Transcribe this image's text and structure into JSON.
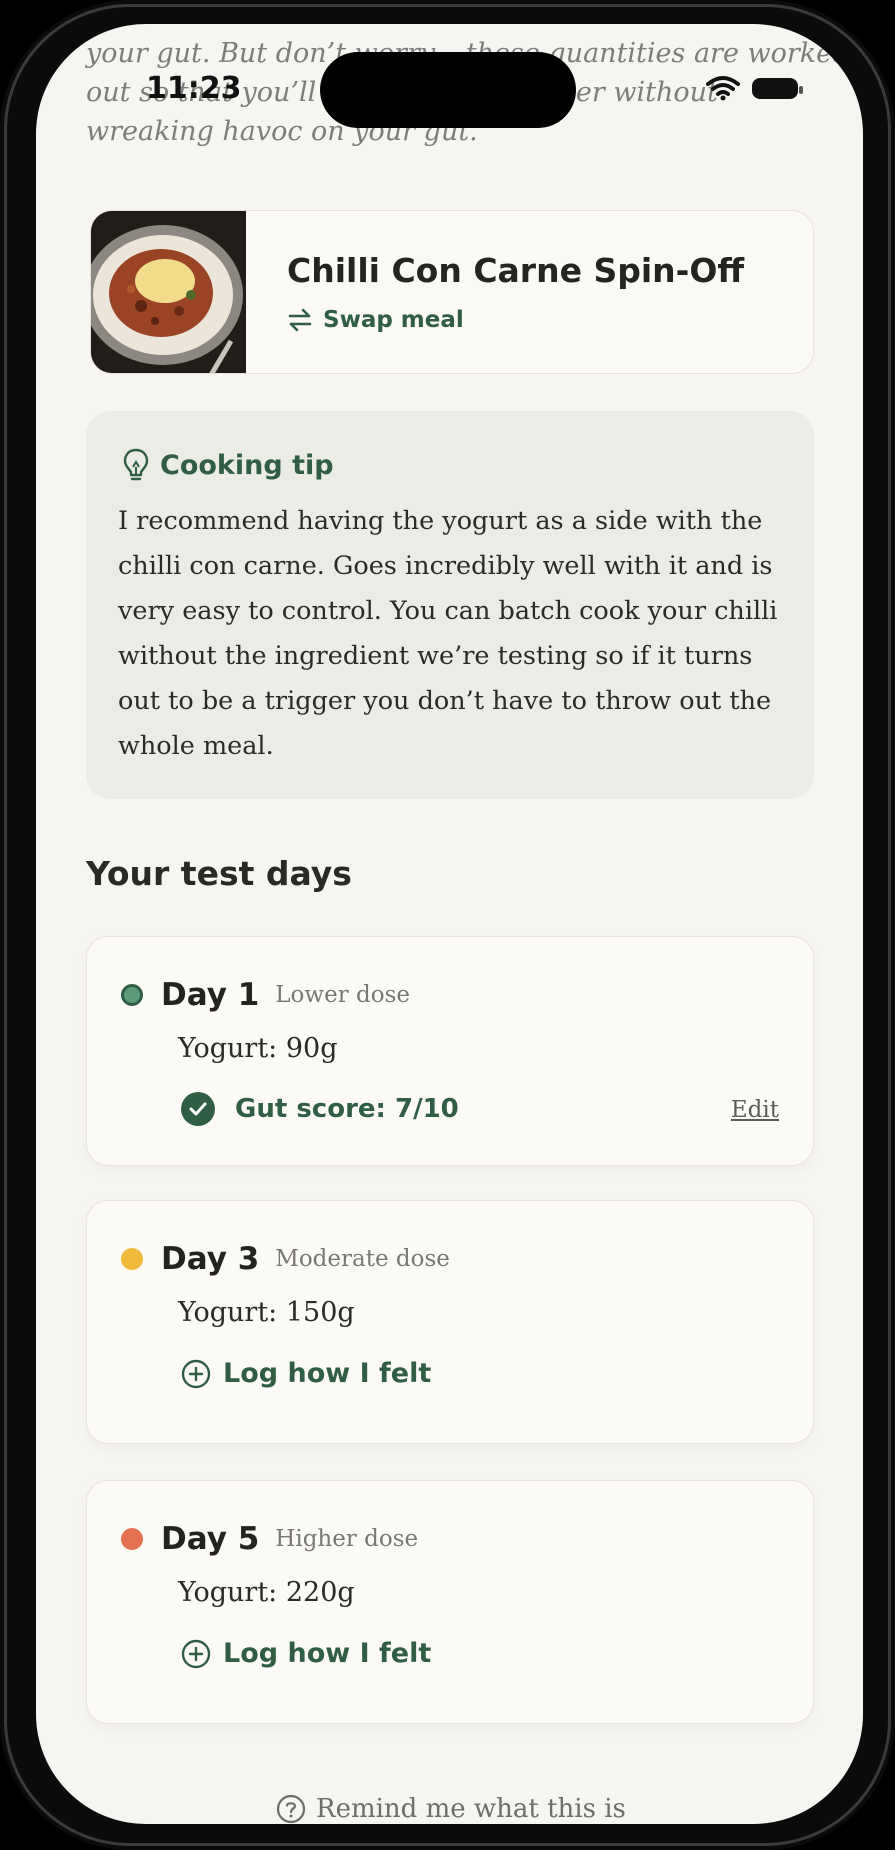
{
  "status_bar": {
    "time": "11:23"
  },
  "intro": {
    "text": "your gut. But don’t worry – these quantities are worked\nout so that you’ll know if it’s a trigger without\nwreaking havoc on your gut."
  },
  "meal": {
    "title": "Chilli Con Carne Spin-Off",
    "swap_label": "Swap meal",
    "image_icon": "chilli-con-carne-photo"
  },
  "tip": {
    "heading": "Cooking tip",
    "icon": "lightbulb-icon",
    "body": "I recommend having the yogurt as a side with the chilli con carne. Goes incredibly well with it and is very easy to control. You can batch cook your chilli without the ingredient we’re testing so if it turns out to be a trigger you don’t have to throw out the whole meal."
  },
  "test_days": {
    "title": "Your test days",
    "days": [
      {
        "name": "Day 1",
        "dose": "Lower dose",
        "amount": "Yogurt: 90g",
        "status_color": "#5c9a7a",
        "score": "Gut score: 7/10",
        "edit_label": "Edit"
      },
      {
        "name": "Day 3",
        "dose": "Moderate dose",
        "amount": "Yogurt: 150g",
        "status_color": "#f0b93a",
        "log_label": "Log how I felt"
      },
      {
        "name": "Day 5",
        "dose": "Higher dose",
        "amount": "Yogurt: 220g",
        "status_color": "#e3704f",
        "log_label": "Log how I felt"
      }
    ]
  },
  "footer": {
    "remind_label": "Remind me what this is"
  },
  "colors": {
    "accent": "#2f5e45",
    "background": "#f6f5f2",
    "tip_background": "#ecece7"
  }
}
